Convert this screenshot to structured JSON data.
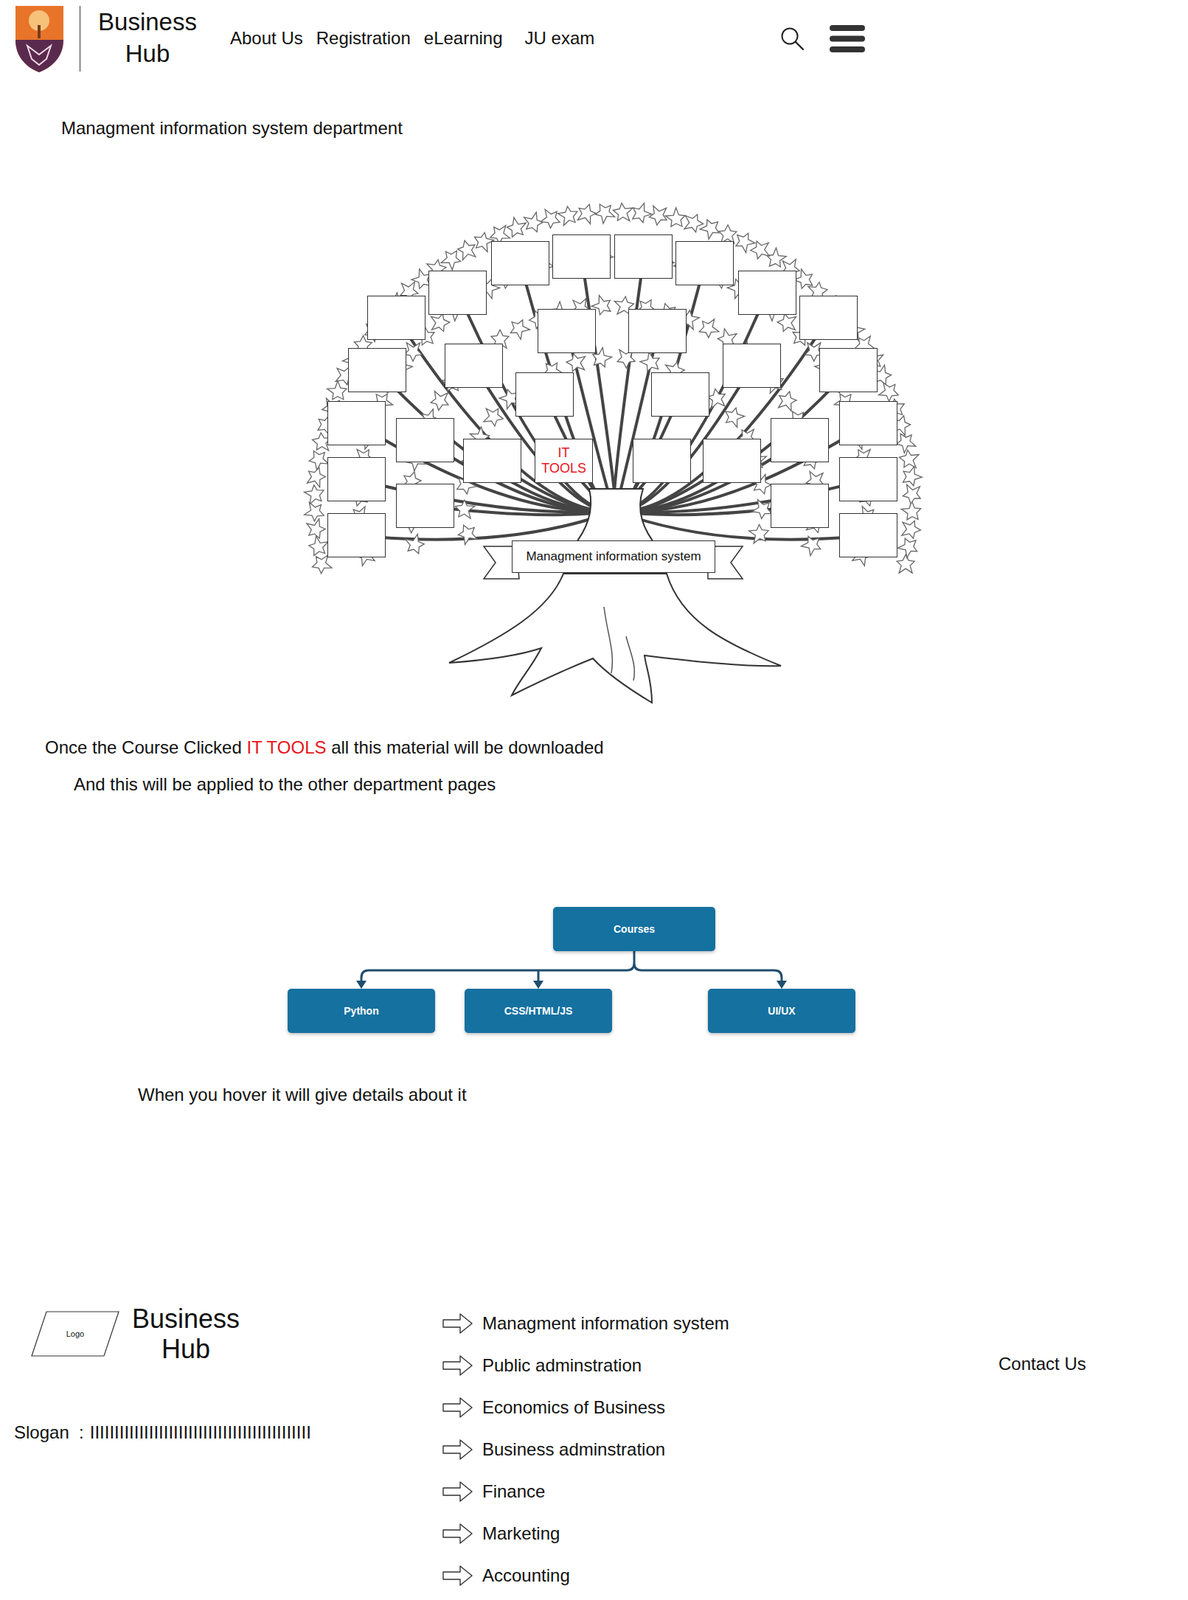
{
  "header": {
    "brand": [
      "Business",
      "Hub"
    ],
    "nav": [
      "About Us",
      "Registration",
      "eLearning",
      "JU exam"
    ]
  },
  "page_title": "Managment information system department",
  "tree": {
    "banner": "Managment information system",
    "course": {
      "label": "IT TOOLS",
      "highlighted": true
    }
  },
  "notes": [
    {
      "parts": [
        {
          "text": "Once the Course Clicked ",
          "highlighted": false
        },
        {
          "text": "IT TOOLS",
          "highlighted": true
        },
        {
          "text": " all this material will be downloaded",
          "highlighted": false
        }
      ]
    },
    {
      "parts": [
        {
          "text": "And this will be applied to the other department pages",
          "highlighted": false
        }
      ]
    }
  ],
  "courses_chart": {
    "root": "Courses",
    "children": [
      "Python",
      "CSS/HTML/JS",
      "UI/UX"
    ]
  },
  "hover_note": "When you hover it will give details about it",
  "footer": {
    "logo": "Logo",
    "brand": [
      "Business",
      "Hub"
    ],
    "slogan_label": "Slogan  :",
    "slogan": "IIIIIIIIIIIIIIIIIIIIIIIIIIIIIIIIIIIIIIIIIIIII",
    "departments": [
      "Managment information system",
      "Public adminstration",
      "Economics of Business",
      "Business adminstration",
      "Finance",
      "Marketing",
      "Accounting"
    ],
    "contact": "Contact Us"
  }
}
